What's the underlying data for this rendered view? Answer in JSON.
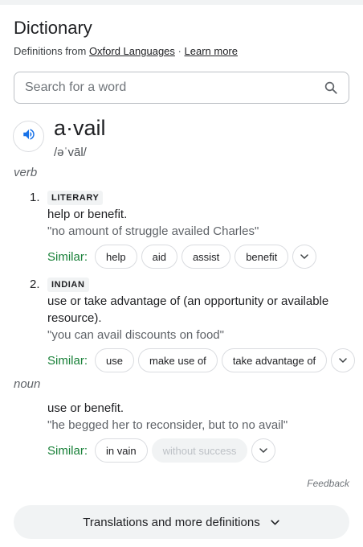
{
  "header": {
    "title": "Dictionary",
    "source_prefix": "Definitions from",
    "source_link": "Oxford Languages",
    "separator": "·",
    "learn_more": "Learn more"
  },
  "search": {
    "placeholder": "Search for a word",
    "value": ""
  },
  "entry": {
    "word": "a·vail",
    "pronunciation": "/əˈvāl/",
    "pos_verb": "verb",
    "pos_noun": "noun",
    "senses": [
      {
        "number": "1.",
        "label": "LITERARY",
        "definition": "help or benefit.",
        "example": "\"no amount of struggle availed Charles\"",
        "similar_label": "Similar:",
        "similar": [
          "help",
          "aid",
          "assist",
          "benefit"
        ]
      },
      {
        "number": "2.",
        "label": "INDIAN",
        "definition": "use or take advantage of (an opportunity or available resource).",
        "example": "\"you can avail discounts on food\"",
        "similar_label": "Similar:",
        "similar": [
          "use",
          "make use of",
          "take advantage of"
        ]
      },
      {
        "definition": "use or benefit.",
        "example": "\"he begged her to reconsider, but to no avail\"",
        "similar_label": "Similar:",
        "similar": [
          "in vain",
          "without success"
        ]
      }
    ]
  },
  "footer": {
    "feedback": "Feedback",
    "more_button": "Translations and more definitions"
  },
  "colors": {
    "similar_green": "#188038",
    "speaker_blue": "#1a73e8",
    "chip_border": "#dadce0"
  }
}
